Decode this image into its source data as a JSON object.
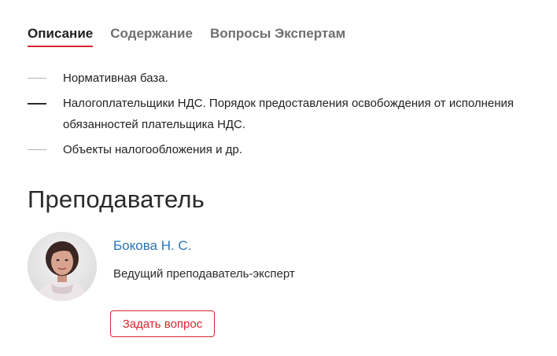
{
  "tabs": [
    {
      "label": "Описание",
      "active": true
    },
    {
      "label": "Содержание",
      "active": false
    },
    {
      "label": "Вопросы Экспертам",
      "active": false
    }
  ],
  "description": {
    "items": [
      {
        "text": "Нормативная база."
      },
      {
        "text": "Налогоплательщики НДС. Порядок предоставления освобождения от исполнения обязанностей плательщика НДС."
      },
      {
        "text": "Объекты налогообложения и др."
      }
    ]
  },
  "teacher_section": {
    "title": "Преподаватель",
    "name": "Бокова Н. С.",
    "role": "Ведущий преподаватель-эксперт",
    "ask_button_label": "Задать вопрос"
  },
  "colors": {
    "accent_red": "#d9262e",
    "link_blue": "#2b74b8"
  }
}
